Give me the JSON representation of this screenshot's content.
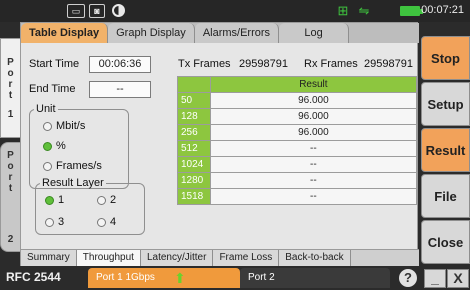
{
  "status": {
    "clock": "00:07:21",
    "icons": [
      "keyboard-icon",
      "screenshot-icon",
      "contrast-icon",
      "lan-icon",
      "usb-icon",
      "battery-icon"
    ]
  },
  "ports_side": {
    "port1": [
      "P",
      "o",
      "r",
      "t",
      "",
      "1"
    ],
    "port2": [
      "P",
      "o",
      "r",
      "t",
      "",
      "2"
    ]
  },
  "tabs": {
    "items": [
      "Table Display",
      "Graph Display",
      "Alarms/Errors",
      "Log"
    ],
    "active": 0
  },
  "fields": {
    "start_time_label": "Start Time",
    "start_time_value": "00:06:36",
    "end_time_label": "End Time",
    "end_time_value": "--",
    "tx_label": "Tx Frames",
    "tx_value": "29598791",
    "rx_label": "Rx Frames",
    "rx_value": "29598791"
  },
  "unit": {
    "legend": "Unit",
    "options": [
      "Mbit/s",
      "%",
      "Frames/s"
    ],
    "selected": 1
  },
  "result_layer": {
    "legend": "Result Layer",
    "options": [
      "1",
      "2",
      "3",
      "4"
    ],
    "selected": 0
  },
  "table": {
    "header": "Result",
    "rows": [
      {
        "size": "50",
        "result": "96.000"
      },
      {
        "size": "128",
        "result": "96.000"
      },
      {
        "size": "256",
        "result": "96.000"
      },
      {
        "size": "512",
        "result": "--"
      },
      {
        "size": "1024",
        "result": "--"
      },
      {
        "size": "1280",
        "result": "--"
      },
      {
        "size": "1518",
        "result": "--"
      }
    ]
  },
  "bottom_tabs": {
    "items": [
      "Summary",
      "Throughput",
      "Latency/Jitter",
      "Frame Loss",
      "Back-to-back"
    ],
    "active": 1
  },
  "right_buttons": [
    "Stop",
    "Setup",
    "Result",
    "File",
    "Close"
  ],
  "footer": {
    "test_name": "RFC 2544",
    "port1": "Port 1  1Gbps",
    "port2": "Port 2",
    "help": "?",
    "minimize": "_",
    "close": "X"
  },
  "colors": {
    "accent_orange": "#f2a25a",
    "table_green": "#8dc63f",
    "status_green": "#3fc43f"
  }
}
